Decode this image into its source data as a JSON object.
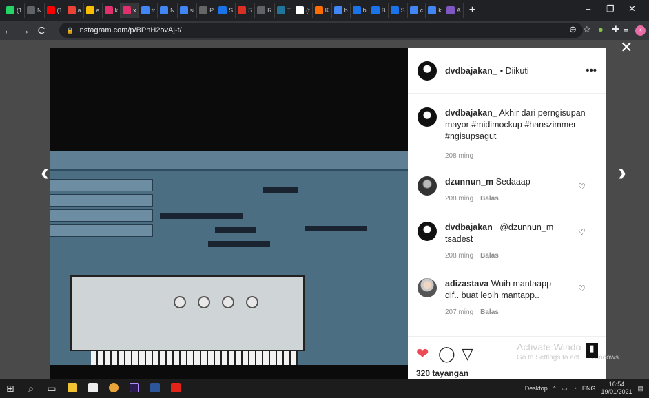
{
  "browser": {
    "tabs": [
      {
        "label": "(1",
        "color": "#25d366"
      },
      {
        "label": "N",
        "color": "#5f6368"
      },
      {
        "label": "(1",
        "color": "#ff0000"
      },
      {
        "label": "a",
        "color": "#ea4335"
      },
      {
        "label": "a",
        "color": "#fbbc04"
      },
      {
        "label": "k",
        "color": "#e1306c"
      },
      {
        "label": "x",
        "color": "#e1306c",
        "active": true
      },
      {
        "label": "tr",
        "color": "#4285f4"
      },
      {
        "label": "N",
        "color": "#4285f4"
      },
      {
        "label": "si",
        "color": "#4285f4"
      },
      {
        "label": "P",
        "color": "#666666"
      },
      {
        "label": "S",
        "color": "#1a73e8"
      },
      {
        "label": "S",
        "color": "#d93025"
      },
      {
        "label": "R",
        "color": "#5f6368"
      },
      {
        "label": "T",
        "color": "#21759b"
      },
      {
        "label": "(t",
        "color": "#ffffff"
      },
      {
        "label": "K",
        "color": "#ff6d00"
      },
      {
        "label": "b",
        "color": "#4285f4"
      },
      {
        "label": "b",
        "color": "#1a73e8"
      },
      {
        "label": "B",
        "color": "#1a73e8"
      },
      {
        "label": "S",
        "color": "#1a73e8"
      },
      {
        "label": "c",
        "color": "#4285f4"
      },
      {
        "label": "k",
        "color": "#4285f4"
      },
      {
        "label": "A",
        "color": "#7e57c2"
      }
    ],
    "new_tab": "+",
    "win_min": "–",
    "win_max": "❐",
    "win_close": "✕",
    "nav_back": "←",
    "nav_forward": "→",
    "nav_reload": "C",
    "url": "instagram.com/p/BPnH2ovAj-t/",
    "profile_initial": "K"
  },
  "post": {
    "username": "dvdbajakan_",
    "follow_status": "• Diikuti",
    "more": "•••",
    "caption": {
      "user": "dvdbajakan_",
      "text": "Akhir dari perngisupan mayor #midimockup #hanszimmer #ngisupsagut",
      "time": "208 ming"
    },
    "comments": [
      {
        "user": "dzunnun_m",
        "text": "Sedaaap",
        "time": "208 ming",
        "reply": "Balas"
      },
      {
        "user": "dvdbajakan_",
        "text": "@dzunnun_m tsadest",
        "time": "208 ming",
        "reply": "Balas"
      },
      {
        "user": "adizastava",
        "text": "Wuih mantaapp dif.. buat lebih mantapp..",
        "time": "207 ming",
        "reply": "Balas"
      }
    ],
    "views": "320 tayangan",
    "prev_arrow": "‹",
    "next_arrow": "›",
    "close": "✕"
  },
  "watermark": {
    "line1": "Activate Windo",
    "line2": "Go to Settings to act",
    "line3": "Windows."
  },
  "taskbar": {
    "desktop_label": "Desktop",
    "lang": "ENG",
    "time": "16:54",
    "date": "19/01/2021"
  },
  "colors": {
    "like_red": "#ed4956",
    "ig_text": "#262626",
    "ig_meta": "#8e8e8e"
  }
}
